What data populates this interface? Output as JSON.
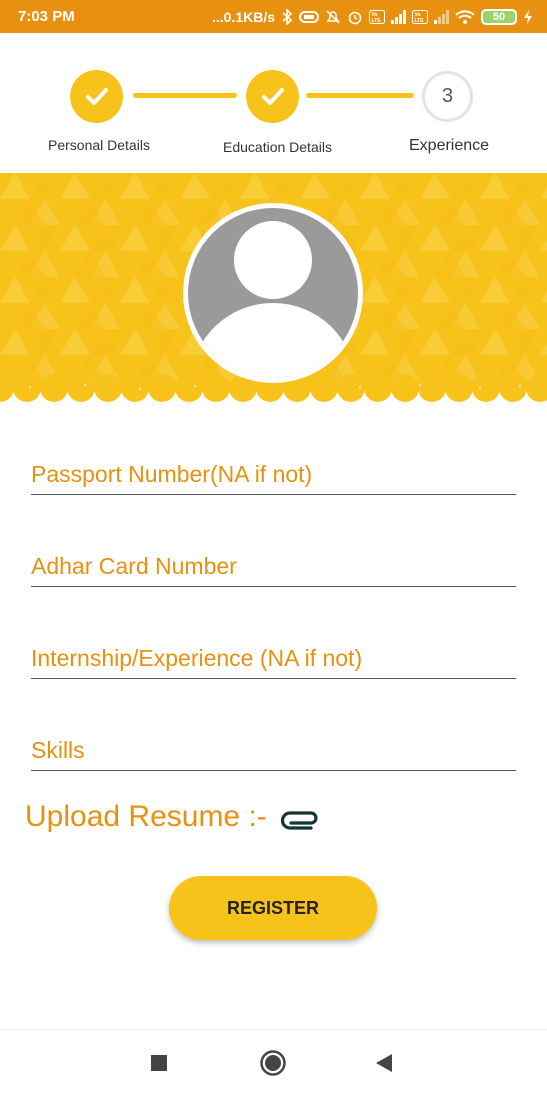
{
  "status_bar": {
    "time": "7:03 PM",
    "network_speed": "...0.1KB/s",
    "battery": "50",
    "icons": [
      "bluetooth-icon",
      "vibrate-icon",
      "mute-icon",
      "alarm-icon",
      "volte-icon",
      "signal-icon",
      "wifi-icon",
      "battery-icon",
      "charging-icon"
    ]
  },
  "stepper": {
    "steps": [
      {
        "label": "Personal Details",
        "state": "done"
      },
      {
        "label": "Education Details",
        "state": "done"
      },
      {
        "label": "Experience",
        "state": "current",
        "number": "3"
      }
    ]
  },
  "profile": {
    "avatar": "person-placeholder-icon"
  },
  "form": {
    "passport_placeholder": "Passport Number(NA if not)",
    "adhar_placeholder": "Adhar Card Number",
    "experience_placeholder": "Internship/Experience (NA if not)",
    "skills_placeholder": "Skills",
    "upload_label": "Upload Resume :-",
    "register_label": "REGISTER"
  },
  "colors": {
    "status_bar": "#E8900F",
    "accent": "#F7C31B",
    "text_accent": "#E8900F"
  },
  "nav_bar": [
    "recent-apps-icon",
    "home-icon",
    "back-icon"
  ]
}
